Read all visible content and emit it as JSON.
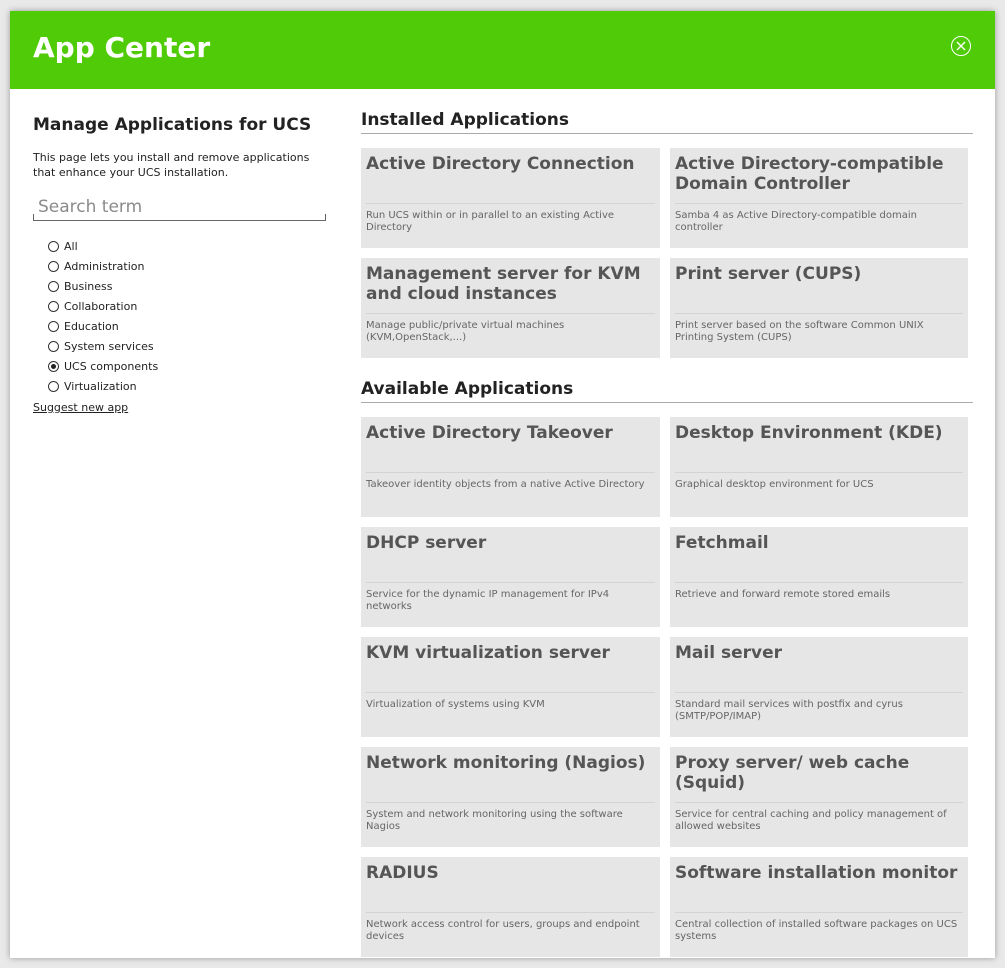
{
  "header": {
    "title": "App Center"
  },
  "sidebar": {
    "heading": "Manage Applications for UCS",
    "description": "This page lets you install and remove applications that enhance your UCS installation.",
    "search_placeholder": "Search term",
    "categories": [
      {
        "label": "All",
        "checked": false
      },
      {
        "label": "Administration",
        "checked": false
      },
      {
        "label": "Business",
        "checked": false
      },
      {
        "label": "Collaboration",
        "checked": false
      },
      {
        "label": "Education",
        "checked": false
      },
      {
        "label": "System services",
        "checked": false
      },
      {
        "label": "UCS components",
        "checked": true
      },
      {
        "label": "Virtualization",
        "checked": false
      }
    ],
    "suggest_link": "Suggest new app"
  },
  "installed": {
    "title": "Installed Applications",
    "apps": [
      {
        "name": "Active Directory Connection",
        "description": "Run UCS within or in parallel to an existing Active Directory"
      },
      {
        "name": "Active Directory-compatible Domain Controller",
        "description": "Samba 4 as Active Directory-compatible domain controller"
      },
      {
        "name": "Management server for KVM and cloud instances",
        "description": "Manage public/private virtual machines (KVM,OpenStack,...)"
      },
      {
        "name": "Print server (CUPS)",
        "description": "Print server based on the software Common UNIX Printing System (CUPS)"
      }
    ]
  },
  "available": {
    "title": "Available Applications",
    "apps": [
      {
        "name": "Active Directory Takeover",
        "description": "Takeover identity objects from a native Active Directory"
      },
      {
        "name": "Desktop Environment (KDE)",
        "description": "Graphical desktop environment for UCS"
      },
      {
        "name": "DHCP server",
        "description": "Service for the dynamic IP management for IPv4 networks"
      },
      {
        "name": "Fetchmail",
        "description": "Retrieve and forward remote stored emails"
      },
      {
        "name": "KVM virtualization server",
        "description": "Virtualization of systems using KVM"
      },
      {
        "name": "Mail server",
        "description": "Standard mail services with postfix and cyrus (SMTP/POP/IMAP)"
      },
      {
        "name": "Network monitoring (Nagios)",
        "description": "System and network monitoring using the software Nagios"
      },
      {
        "name": "Proxy server/ web cache (Squid)",
        "description": "Service for central caching and policy management of allowed websites"
      },
      {
        "name": "RADIUS",
        "description": "Network access control for users, groups and endpoint devices"
      },
      {
        "name": "Software installation monitor",
        "description": "Central collection of installed software packages on UCS systems"
      }
    ]
  },
  "colors": {
    "header": "#4fcb07",
    "card": "#e6e6e6"
  },
  "icons": {
    "close": "close-icon"
  }
}
